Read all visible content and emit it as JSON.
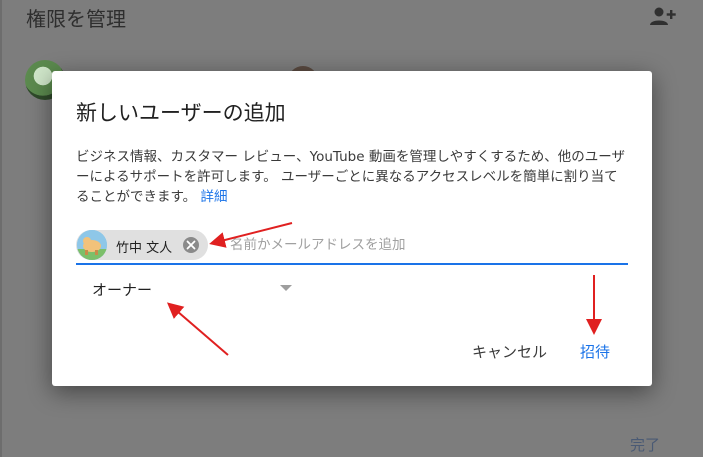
{
  "background": {
    "header_title": "権限を管理",
    "done_label": "完了"
  },
  "dialog": {
    "title": "新しいユーザーの追加",
    "description": "ビジネス情報、カスタマー レビュー、YouTube 動画を管理しやすくするため、他のユーザーによるサポートを許可します。 ユーザーごとに異なるアクセスレベルを簡単に割り当てることができます。",
    "details_link": "詳細",
    "recipient": {
      "chip_name": "竹中 文人",
      "placeholder": "名前かメールアドレスを追加",
      "value": ""
    },
    "role": {
      "selected": "オーナー"
    },
    "buttons": {
      "cancel": "キャンセル",
      "invite": "招待"
    }
  },
  "colors": {
    "accent": "#1a73e8",
    "annotation_arrow": "#e02020",
    "scrim": "#7d7d7d"
  },
  "icons": {
    "header_action": "add-user-icon",
    "chip_remove": "close-circle-icon",
    "role_dropdown": "caret-down-icon"
  }
}
